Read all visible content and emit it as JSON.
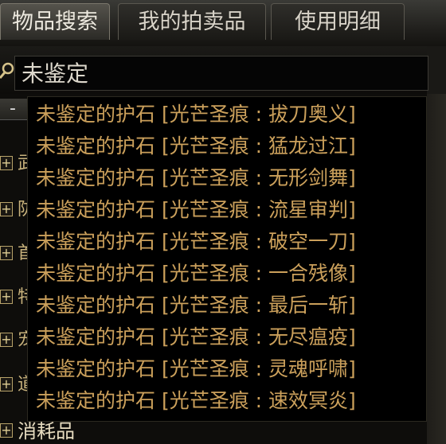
{
  "tabs": [
    {
      "label": "物品搜索"
    },
    {
      "label": "我的拍卖品"
    },
    {
      "label": "使用明细"
    }
  ],
  "search": {
    "value": "未鉴定"
  },
  "categories": [
    {
      "fragment": "武"
    },
    {
      "fragment": "防"
    },
    {
      "fragment": "首"
    },
    {
      "fragment": "特"
    },
    {
      "fragment": "宠"
    },
    {
      "fragment": "道"
    },
    {
      "fragment": "消耗品"
    }
  ],
  "suggestions": [
    "未鉴定的护石 [光芒圣痕 : 拔刀奥义]",
    "未鉴定的护石 [光芒圣痕 : 猛龙过江]",
    "未鉴定的护石 [光芒圣痕 : 无形剑舞]",
    "未鉴定的护石 [光芒圣痕 : 流星审判]",
    "未鉴定的护石 [光芒圣痕 : 破空一刀]",
    "未鉴定的护石 [光芒圣痕 : 一合残像]",
    "未鉴定的护石 [光芒圣痕 : 最后一斩]",
    "未鉴定的护石 [光芒圣痕 : 无尽瘟疫]",
    "未鉴定的护石 [光芒圣痕 : 灵魂呼啸]",
    "未鉴定的护石 [光芒圣痕 : 速效冥炎]"
  ],
  "colors": {
    "suggestion_text": "#cba05b",
    "expander_border": "#b8a36a",
    "background": "#0b0a08"
  }
}
